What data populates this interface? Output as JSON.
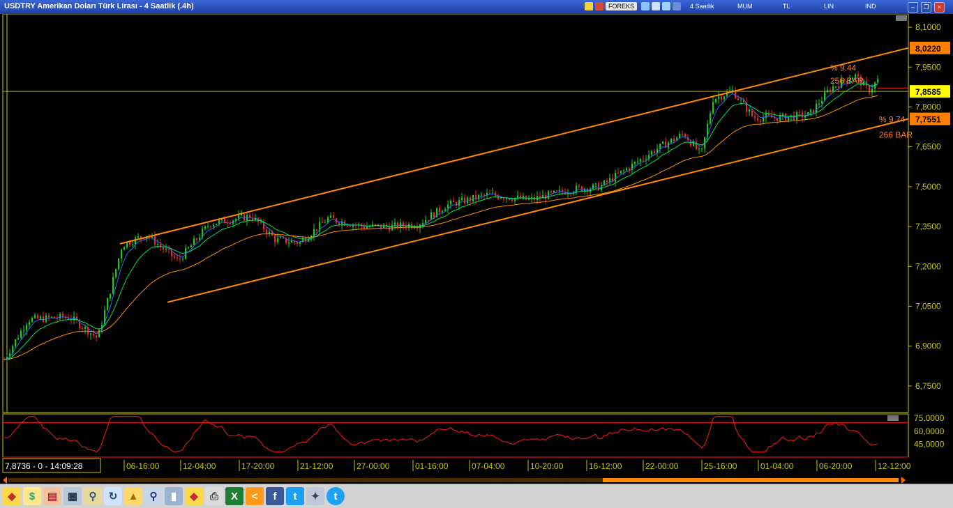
{
  "window": {
    "title": "USDTRY Amerikan Doları Türk Lirası - 4 Saatlik (.4h)",
    "source_tag": "FOREKS",
    "timeframe": "4 Saatlik",
    "chart_type": "MUM",
    "currency": "TL",
    "scale": "LIN",
    "indicators": "IND",
    "buttons": {
      "minimize": "–",
      "restore": "❐",
      "close": "×"
    }
  },
  "chart_data": {
    "type": "candlestick",
    "y_ticks": [
      "8,1000",
      "7,9500",
      "7,8000",
      "7,6500",
      "7,5000",
      "7,3500",
      "7,2000",
      "7,0500",
      "6,9000",
      "6,7500"
    ],
    "x_ticks": [
      "06-16:00",
      "12-04:00",
      "17-20:00",
      "21-12:00",
      "27-00:00",
      "01-16:00",
      "07-04:00",
      "10-20:00",
      "16-12:00",
      "22-00:00",
      "25-16:00",
      "01-04:00",
      "06-20:00",
      "12-12:00"
    ],
    "ylim": [
      6.65,
      8.15
    ],
    "price_labels": [
      {
        "value": "8,0220",
        "color": "#ff8000"
      },
      {
        "value": "7,8585",
        "color": "#ffff00"
      },
      {
        "value": "7,7551",
        "color": "#ff8000"
      }
    ],
    "annotations": [
      {
        "text": "% 9.44",
        "color": "#ff7a1a"
      },
      {
        "text": "256 BAR",
        "color": "#ff7a1a"
      },
      {
        "text": "% 9.74",
        "color": "#ff7a1a"
      },
      {
        "text": "266 BAR",
        "color": "#ff7a1a"
      }
    ],
    "current_price": "7,8585",
    "oscillator": {
      "y_ticks": [
        "75,0000",
        "60,0000",
        "45,0000"
      ],
      "levels": [
        70,
        30
      ],
      "ylim": [
        30,
        80
      ]
    },
    "bottom_readout": "7,8736 - 0 - 14:09:28"
  },
  "colors": {
    "bull": "#00e000",
    "bear": "#ff2020",
    "ema_fast": "#2a6cff",
    "ema_mid": "#00e060",
    "ema_slow": "#ff8c00",
    "channel": "#ff8c00",
    "axis": "#c8c800",
    "oscillator": "#ff1a1a"
  }
}
